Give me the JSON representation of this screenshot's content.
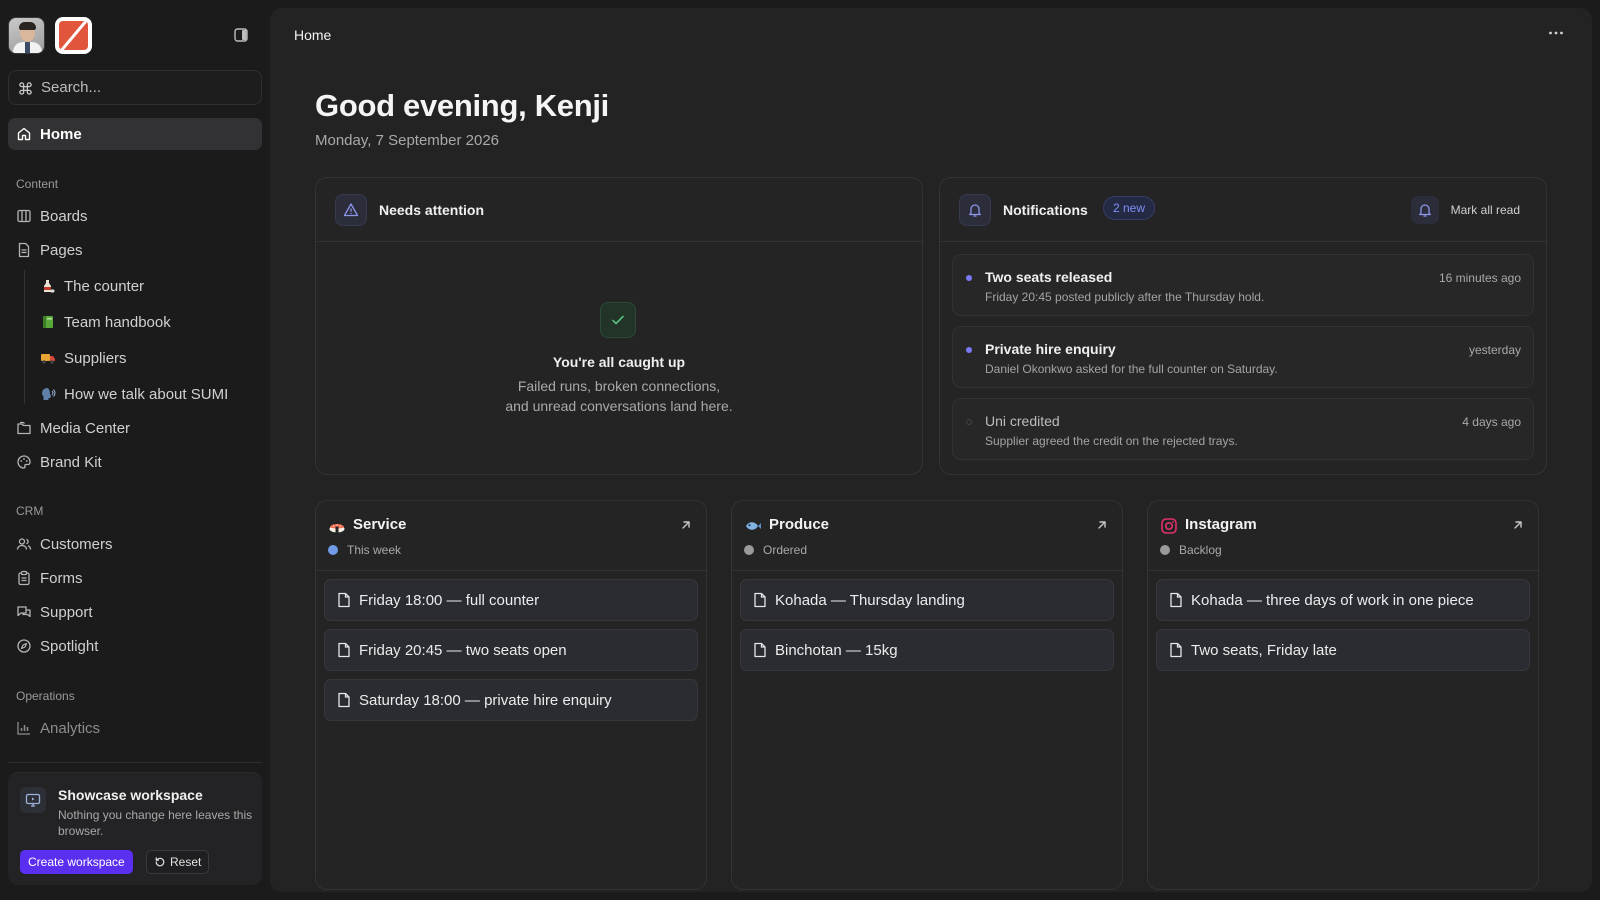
{
  "sidebar": {
    "search_placeholder": "Search...",
    "home_label": "Home",
    "sections": {
      "content": "Content",
      "crm": "CRM",
      "operations": "Operations"
    },
    "items": {
      "boards": "Boards",
      "pages": "Pages",
      "page_counter": "The counter",
      "page_handbook": "Team handbook",
      "page_suppliers": "Suppliers",
      "page_sumi": "How we talk about SUMI",
      "media_center": "Media Center",
      "brand_kit": "Brand Kit",
      "customers": "Customers",
      "forms": "Forms",
      "support": "Support",
      "spotlight": "Spotlight",
      "analytics": "Analytics"
    },
    "workspace": {
      "title": "Showcase workspace",
      "description": "Nothing you change here leaves this browser.",
      "create_label": "Create workspace",
      "reset_label": "Reset"
    }
  },
  "header": {
    "breadcrumb": "Home"
  },
  "main": {
    "greeting": "Good evening, Kenji",
    "date": "Monday, 7 September 2026",
    "attention": {
      "title": "Needs attention",
      "empty_title": "You're all caught up",
      "empty_line1": "Failed runs, broken connections,",
      "empty_line2": "and unread conversations land here."
    },
    "notifications": {
      "title": "Notifications",
      "badge": "2 new",
      "mark_all": "Mark all read",
      "items": [
        {
          "title": "Two seats released",
          "desc": "Friday 20:45 posted publicly after the Thursday hold.",
          "time": "16 minutes ago",
          "unread": true
        },
        {
          "title": "Private hire enquiry",
          "desc": "Daniel Okonkwo asked for the full counter on Saturday.",
          "time": "yesterday",
          "unread": true
        },
        {
          "title": "Uni credited",
          "desc": "Supplier agreed the credit on the rejected trays.",
          "time": "4 days ago",
          "unread": false
        }
      ]
    },
    "boards": [
      {
        "title": "Service",
        "status": "This week",
        "status_color": "#6f9be8",
        "cards": [
          "Friday 18:00 — full counter",
          "Friday 20:45 — two seats open",
          "Saturday 18:00 — private hire enquiry"
        ]
      },
      {
        "title": "Produce",
        "status": "Ordered",
        "status_color": "#9a9a9a",
        "cards": [
          "Kohada — Thursday landing",
          "Binchotan — 15kg"
        ]
      },
      {
        "title": "Instagram",
        "status": "Backlog",
        "status_color": "#9a9a9a",
        "cards": [
          "Kohada — three days of work in one piece",
          "Two seats, Friday late"
        ]
      }
    ]
  },
  "colors": {
    "accent": "#5b2ff0",
    "unread_dot": "#7a7af5",
    "success": "#4caf73"
  }
}
